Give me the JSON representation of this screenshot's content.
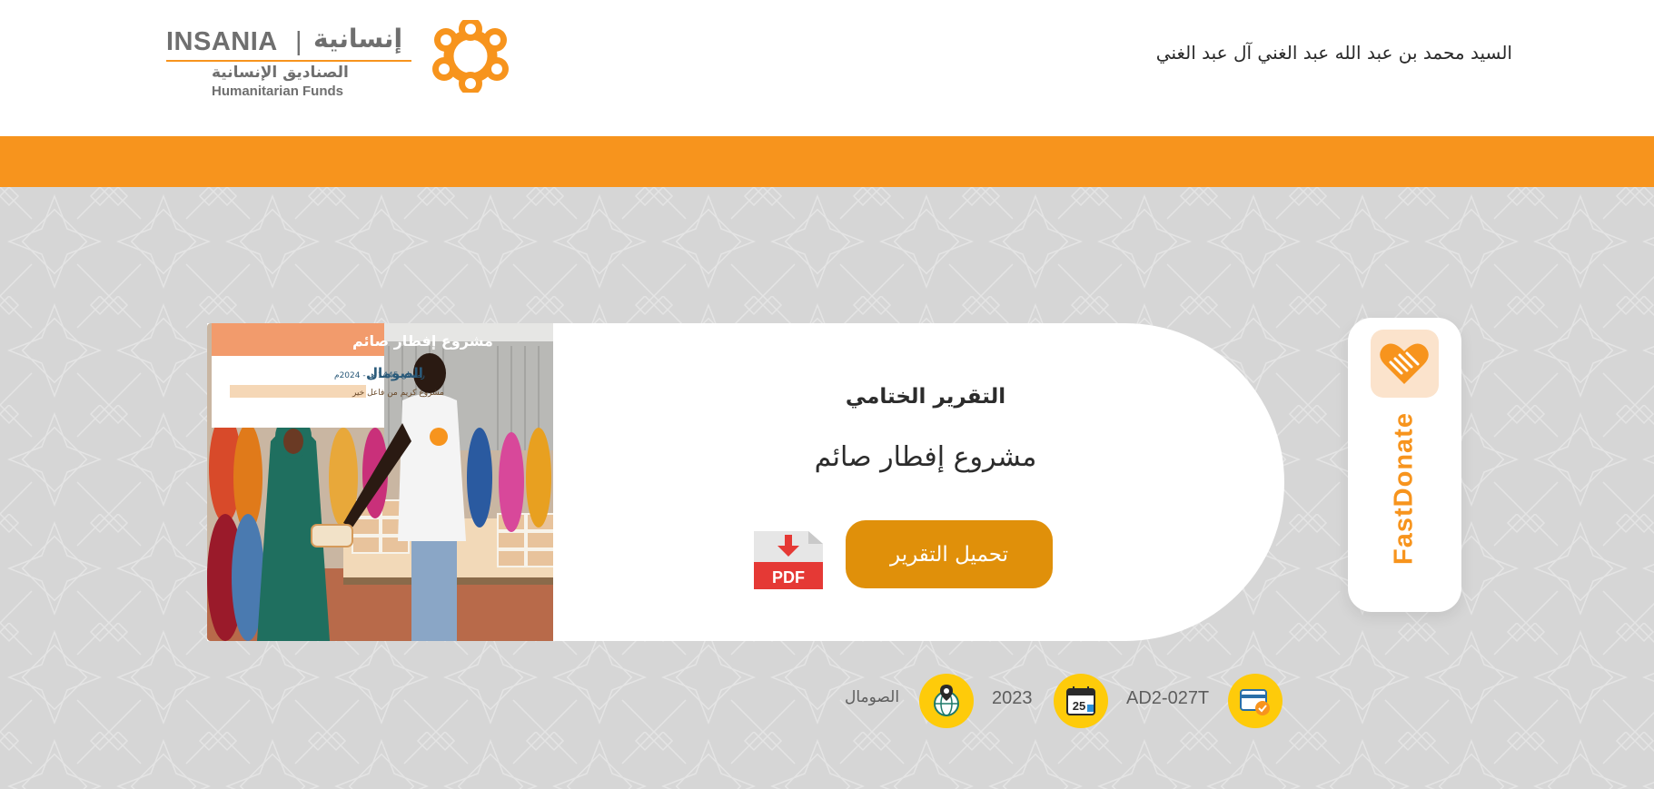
{
  "header": {
    "logo": {
      "en_name": "INSANIA",
      "separator": "|",
      "ar_name": "إنسانية",
      "ar_subtitle": "الصناديق الإنسانية",
      "en_subtitle": "Humanitarian Funds",
      "icon": "flower-logo-icon"
    },
    "donor_name": "السيد محمد بن عبد الله عبد الغني آل عبد الغني"
  },
  "colors": {
    "accent_orange": "#f7941d",
    "button_gold": "#e0900a",
    "info_icon_yellow": "#fecb0a",
    "background_gray": "#d6d6d6"
  },
  "card": {
    "title": "التقرير الختامي",
    "project_name": "مشروع إفطار صائم",
    "download_label": "تحميل التقرير",
    "pdf_icon": "pdf-file-icon",
    "pdf_text": "PDF",
    "photo": {
      "banner_title": "مشروع إفطار صائم",
      "banner_country": "الصومال",
      "banner_date": "رمضان 1445 هـ - 2024م",
      "banner_sub": "مشروع كريم من فاعل خير"
    }
  },
  "fast_donate": {
    "label": "FastDonate",
    "icon": "heart-handshake-icon"
  },
  "info": {
    "code": "AD2-027T",
    "code_icon": "card-payment-icon",
    "year": "2023",
    "year_icon": "calendar-icon",
    "calendar_day": "25",
    "country": "الصومال",
    "country_icon": "globe-location-icon"
  }
}
